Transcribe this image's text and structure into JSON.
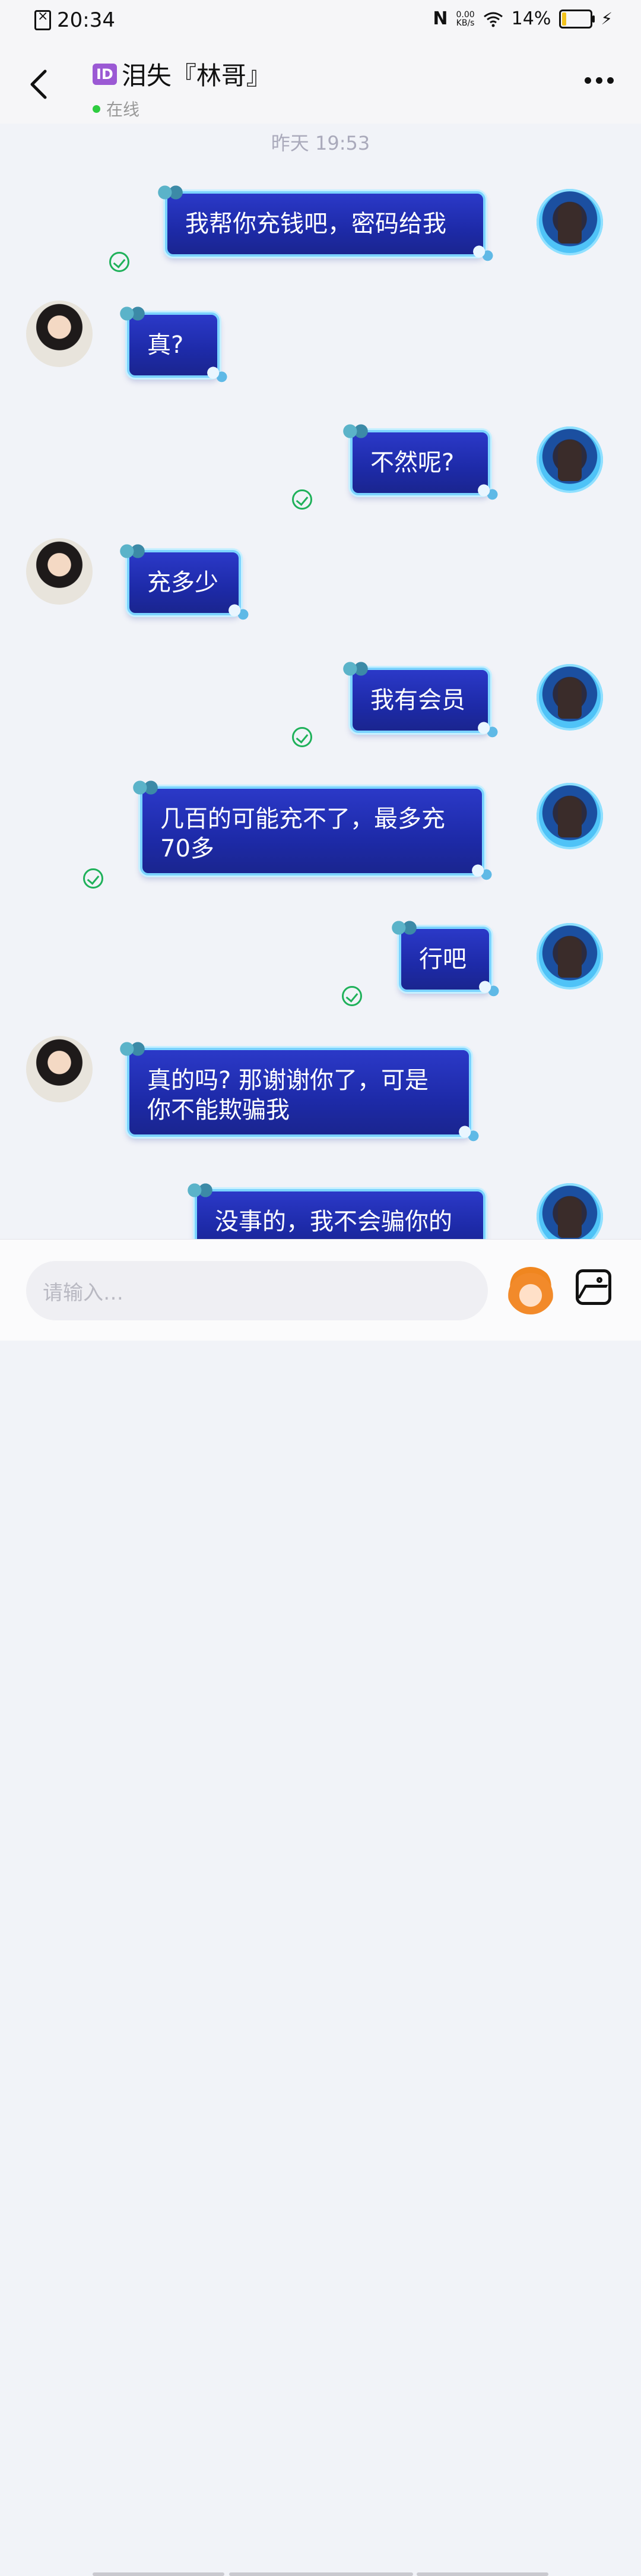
{
  "status_bar": {
    "time": "20:34",
    "nfc": "N",
    "net_speed_value": "0.00",
    "net_speed_unit": "KB/s",
    "battery": "14%",
    "battery_level": 0.14
  },
  "header": {
    "id_badge": "ID",
    "contact_name": "泪失『林哥』",
    "status": "在线"
  },
  "chat": {
    "timestamp": "昨天 19:53",
    "messages": [
      {
        "side": "self",
        "text": "我帮你充钱吧，密码给我"
      },
      {
        "side": "other",
        "text": "真?"
      },
      {
        "side": "self",
        "text": "不然呢?"
      },
      {
        "side": "other",
        "text": "充多少"
      },
      {
        "side": "self",
        "text": "我有会员"
      },
      {
        "side": "self",
        "text": "几百的可能充不了，最多充70多"
      },
      {
        "side": "self",
        "text": "行吧"
      },
      {
        "side": "other",
        "text": "真的吗? 那谢谢你了，可是你不能欺骗我"
      },
      {
        "side": "self",
        "text": "没事的，我不会骗你的"
      }
    ]
  },
  "input": {
    "placeholder": "请输入…"
  },
  "icons": {
    "back": "chevron-left-icon",
    "more": "more-dots-icon",
    "read_receipt": "check-circle-icon",
    "emoji": "emoji-sticker-icon",
    "image": "image-icon"
  },
  "colors": {
    "bubble": "#1f2db5",
    "bubble_border": "#7bd3ff",
    "read_check": "#1fb15a",
    "online_dot": "#2ecc40"
  }
}
